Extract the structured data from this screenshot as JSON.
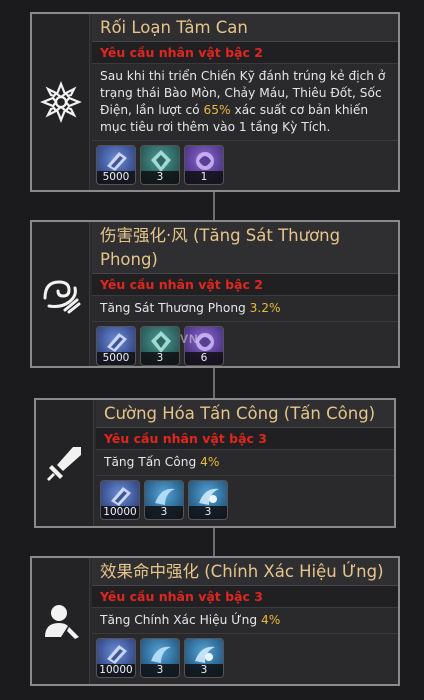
{
  "watermark": "VN",
  "skills": [
    {
      "title": "Rối Loạn Tâm Can",
      "requirement": "Yêu cầu nhân vật bậc 2",
      "desc_parts": [
        "Sau khi thi triển Chiến Kỹ đánh trúng kẻ địch ở trạng thái Bào Mòn, Chảy Máu, Thiêu Đốt, Sốc Điện, lần lượt có ",
        "65%",
        " xác suất cơ bản khiến mục tiêu rơi thêm vào 1 tầng Kỳ Tích."
      ],
      "icon": "ornate-flower-icon",
      "materials": [
        {
          "count": "5000",
          "icon": "credit-item-icon"
        },
        {
          "count": "3",
          "icon": "teal-material-icon"
        },
        {
          "count": "1",
          "icon": "purple-material-icon"
        }
      ]
    },
    {
      "title": "伤害强化·风 (Tăng Sát Thương Phong)",
      "requirement": "Yêu cầu nhân vật bậc 2",
      "desc_parts": [
        "Tăng Sát Thương Phong ",
        "3.2%",
        ""
      ],
      "icon": "wind-swirl-icon",
      "materials": [
        {
          "count": "5000",
          "icon": "credit-item-icon"
        },
        {
          "count": "3",
          "icon": "teal-material-icon"
        },
        {
          "count": "6",
          "icon": "purple-material-icon"
        }
      ]
    },
    {
      "title": "Cường Hóa Tấn Công (Tấn Công)",
      "requirement": "Yêu cầu nhân vật bậc 3",
      "desc_parts": [
        "Tăng Tấn Công ",
        "4%",
        ""
      ],
      "icon": "sword-icon",
      "materials": [
        {
          "count": "10000",
          "icon": "credit-item-icon"
        },
        {
          "count": "3",
          "icon": "cyan-material-icon"
        },
        {
          "count": "3",
          "icon": "cyan-material-icon"
        }
      ]
    },
    {
      "title": "效果命中强化 (Chính Xác Hiệu Ứng)",
      "requirement": "Yêu cầu nhân vật bậc 3",
      "desc_parts": [
        "Tăng Chính Xác Hiệu Ứng ",
        "4%",
        ""
      ],
      "icon": "user-target-icon",
      "materials": [
        {
          "count": "10000",
          "icon": "credit-item-icon"
        },
        {
          "count": "3",
          "icon": "cyan-material-icon"
        },
        {
          "count": "3",
          "icon": "cyan-material-icon"
        }
      ]
    }
  ]
}
